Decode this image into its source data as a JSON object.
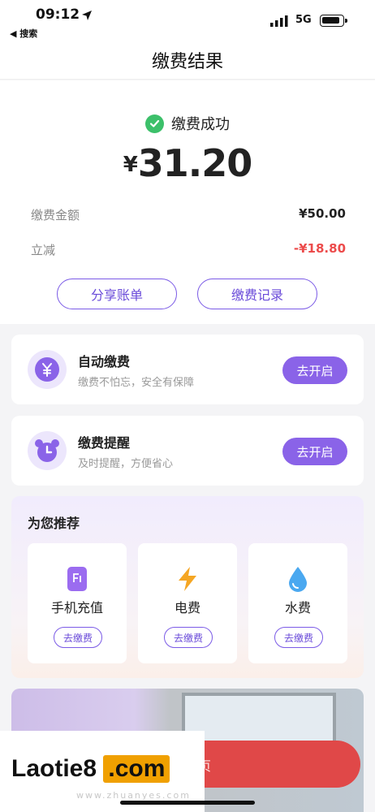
{
  "status_bar": {
    "time": "09:12",
    "back_label": "◀ 搜索",
    "network": "5G"
  },
  "nav": {
    "title": "缴费结果"
  },
  "result": {
    "status_text": "缴费成功",
    "currency": "¥",
    "amount": "31.20",
    "rows": [
      {
        "label": "缴费金额",
        "value": "¥50.00"
      },
      {
        "label": "立减",
        "value": "-¥18.80"
      }
    ],
    "share_label": "分享账单",
    "records_label": "缴费记录"
  },
  "services": [
    {
      "title": "自动缴费",
      "subtitle": "缴费不怕忘，安全有保障",
      "button": "去开启",
      "icon": "yen-icon"
    },
    {
      "title": "缴费提醒",
      "subtitle": "及时提醒，方便省心",
      "button": "去开启",
      "icon": "alarm-clock-icon"
    }
  ],
  "recommend": {
    "title": "为您推荐",
    "items": [
      {
        "label": "手机充值",
        "button": "去缴费",
        "icon": "phone-icon"
      },
      {
        "label": "电费",
        "button": "去缴费",
        "icon": "lightning-icon"
      },
      {
        "label": "水费",
        "button": "去缴费",
        "icon": "water-drop-icon"
      }
    ]
  },
  "bottom": {
    "button_text": "回首页"
  },
  "watermark": {
    "main": "Laotie8",
    "box": ".com",
    "sub": "www.zhuanyes.com"
  },
  "colors": {
    "accent": "#8a63e8",
    "success": "#3cc06a",
    "discount": "#ec4b4b",
    "bottom_button": "#e04848"
  }
}
